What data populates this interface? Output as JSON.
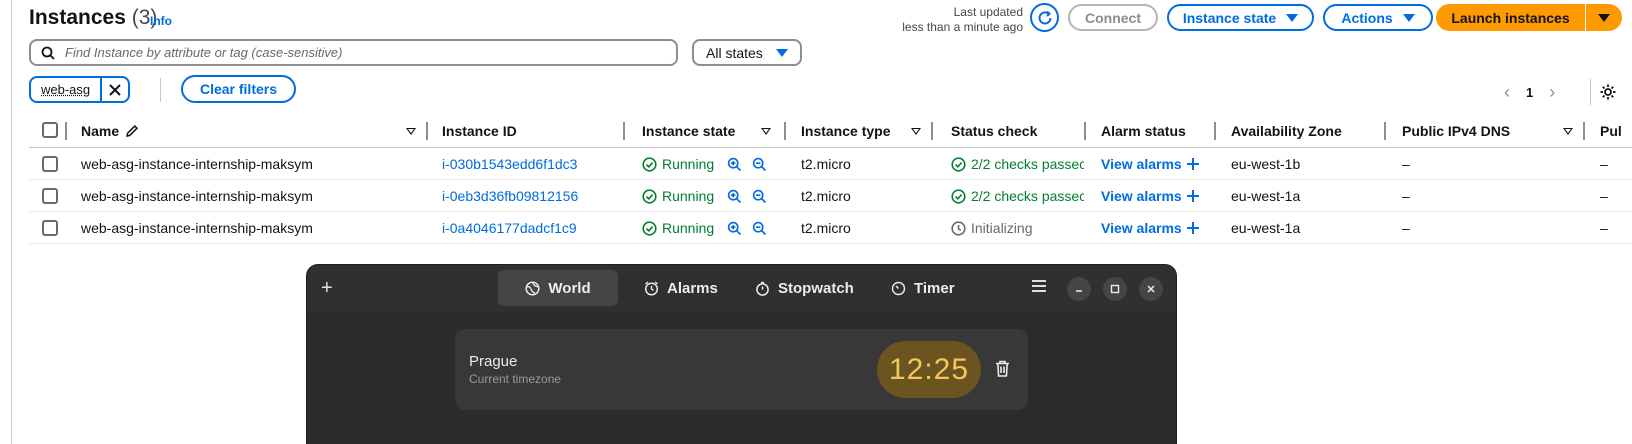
{
  "header": {
    "title": "Instances",
    "count": "(3)",
    "info": "Info",
    "last_updated_line1": "Last updated",
    "last_updated_line2": "less than a minute ago",
    "connect": "Connect",
    "instance_state": "Instance state",
    "actions": "Actions",
    "launch": "Launch instances"
  },
  "search": {
    "placeholder": "Find Instance by attribute or tag (case-sensitive)",
    "states_select": "All states"
  },
  "filters": {
    "token": "web-asg",
    "clear": "Clear filters"
  },
  "pagination": {
    "page": "1"
  },
  "table": {
    "columns": {
      "name": "Name",
      "instance_id": "Instance ID",
      "instance_state": "Instance state",
      "instance_type": "Instance type",
      "status_check": "Status check",
      "alarm_status": "Alarm status",
      "az": "Availability Zone",
      "ipv4_dns": "Public IPv4 DNS",
      "pub": "Pul"
    },
    "rows": [
      {
        "name": "web-asg-instance-internship-maksym",
        "id": "i-030b1543edd6f1dc3",
        "state": "Running",
        "type": "t2.micro",
        "status": "2/2 checks passec",
        "alarm": "View alarms",
        "az": "eu-west-1b",
        "dns": "–",
        "pub": "–"
      },
      {
        "name": "web-asg-instance-internship-maksym",
        "id": "i-0eb3d36fb09812156",
        "state": "Running",
        "type": "t2.micro",
        "status": "2/2 checks passec",
        "alarm": "View alarms",
        "az": "eu-west-1a",
        "dns": "–",
        "pub": "–"
      },
      {
        "name": "web-asg-instance-internship-maksym",
        "id": "i-0a4046177dadcf1c9",
        "state": "Running",
        "type": "t2.micro",
        "status": "Initializing",
        "alarm": "View alarms",
        "az": "eu-west-1a",
        "dns": "–",
        "pub": "–"
      }
    ]
  },
  "clock": {
    "tabs": [
      "World",
      "Alarms",
      "Stopwatch",
      "Timer"
    ],
    "city": "Prague",
    "city_sub": "Current timezone",
    "time": "12:25"
  },
  "colors": {
    "link": "#006ce0",
    "running": "#00802f",
    "launch": "#ff9900",
    "clock_bg": "#2b2b2b",
    "clock_time": "#f4c75a"
  }
}
